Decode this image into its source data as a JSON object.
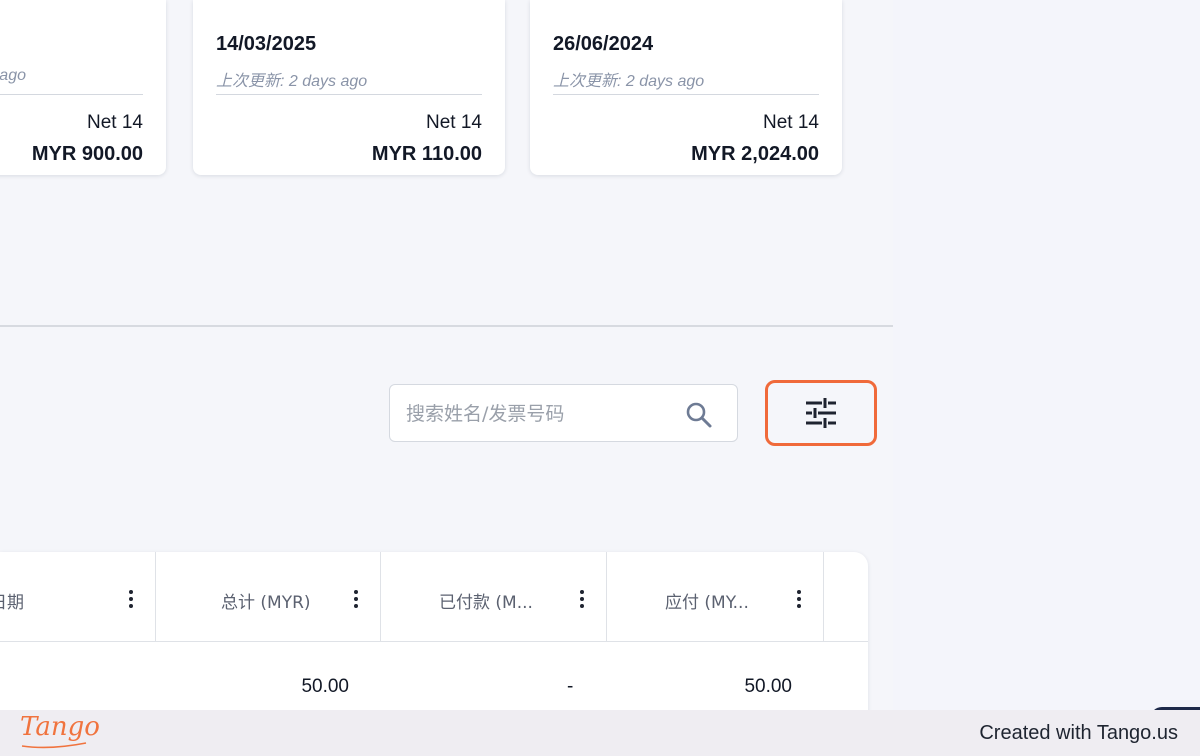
{
  "cards": [
    {
      "date": "",
      "updated": "ago",
      "terms": "Net 14",
      "amount": "MYR 900.00"
    },
    {
      "date": "14/03/2025",
      "updated": "上次更新: 2 days ago",
      "terms": "Net 14",
      "amount": "MYR 110.00"
    },
    {
      "date": "26/06/2024",
      "updated": "上次更新: 2 days ago",
      "terms": "Net 14",
      "amount": "MYR 2,024.00"
    }
  ],
  "search": {
    "placeholder": "搜索姓名/发票号码",
    "value": ""
  },
  "icons": {
    "search": "search-icon",
    "filter": "sliders-icon",
    "column_menu": "more-vertical-icon"
  },
  "table": {
    "columns": [
      "日期",
      "总计 (MYR)",
      "已付款 (M...",
      "应付 (MY..."
    ],
    "rows": [
      {
        "total": "50.00",
        "paid": "-",
        "due": "50.00"
      }
    ]
  },
  "footer": {
    "logo": "Tango",
    "created_with": "Created with Tango.us"
  },
  "colors": {
    "accent": "#f06a3a",
    "background": "#f5f6fa",
    "card": "#ffffff"
  }
}
